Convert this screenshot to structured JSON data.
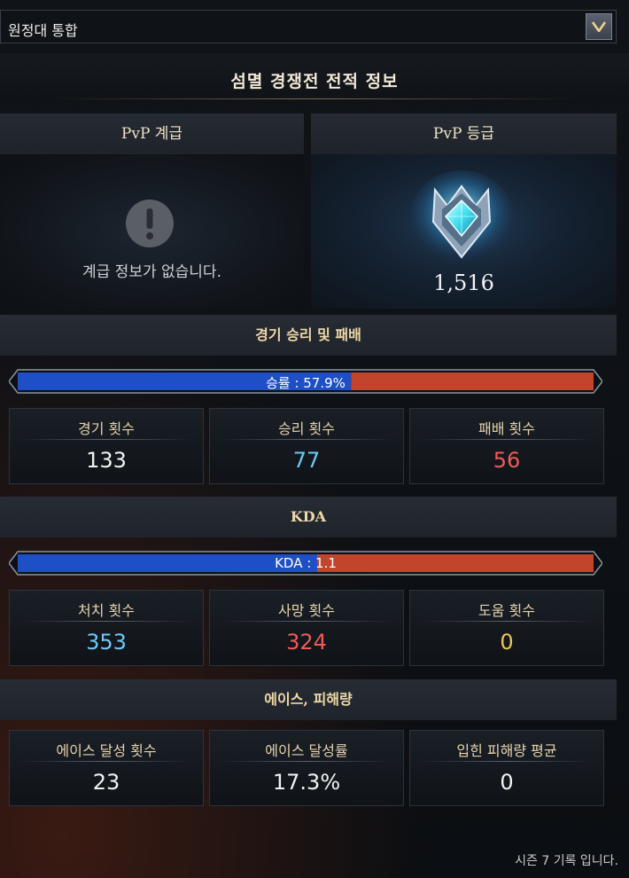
{
  "dropdown": {
    "label": "원정대 통합"
  },
  "title": "섬멸 경쟁전 전적 정보",
  "pvp": {
    "rank_title": "PvP 계급",
    "rank_empty": "계급 정보가 없습니다.",
    "grade_title": "PvP 등급",
    "grade_score": "1,516"
  },
  "win_loss": {
    "title": "경기 승리 및 패배",
    "ratio_label": "승률 : 57.9%",
    "ratio": 0.579,
    "stats": [
      {
        "label": "경기 횟수",
        "value": "133"
      },
      {
        "label": "승리 횟수",
        "value": "77"
      },
      {
        "label": "패배 횟수",
        "value": "56"
      }
    ]
  },
  "kda": {
    "title": "KDA",
    "ratio_label": "KDA : 1.1",
    "ratio": 0.52,
    "stats": [
      {
        "label": "처치 횟수",
        "value": "353"
      },
      {
        "label": "사망 횟수",
        "value": "324"
      },
      {
        "label": "도움 횟수",
        "value": "0"
      }
    ]
  },
  "ace": {
    "title": "에이스, 피해량",
    "stats": [
      {
        "label": "에이스 달성 횟수",
        "value": "23"
      },
      {
        "label": "에이스 달성률",
        "value": "17.3%"
      },
      {
        "label": "입힌 피해량 평균",
        "value": "0"
      }
    ]
  },
  "footer": "시즌 7 기록 입니다.",
  "colors": {
    "win": "#6ec9f2",
    "loss": "#ef5a55",
    "assist": "#f0c54a",
    "neutral": "#f2f2f2",
    "bar_blue": "#1f4fc4",
    "bar_red": "#c0452c"
  }
}
